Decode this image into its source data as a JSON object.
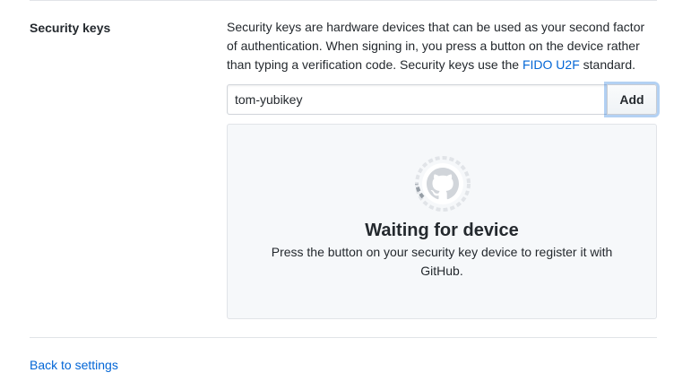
{
  "section": {
    "label": "Security keys",
    "description_before_link": "Security keys are hardware devices that can be used as your second factor of authentication. When signing in, you press a button on the device rather than typing a verification code. Security keys use the ",
    "link_text": "FIDO U2F",
    "description_after_link": " standard."
  },
  "form": {
    "key_name_value": "tom-yubikey",
    "add_label": "Add"
  },
  "waiting": {
    "icon": "github-octocat-spinner-icon",
    "title": "Waiting for device",
    "text": "Press the button on your security key device to register it with GitHub."
  },
  "footer": {
    "back_link": "Back to settings"
  },
  "colors": {
    "link": "#0366d6",
    "text": "#24292e",
    "panel_bg": "#f6f8fa",
    "border": "#e1e4e8",
    "focus_ring": "#c8d9f0"
  }
}
